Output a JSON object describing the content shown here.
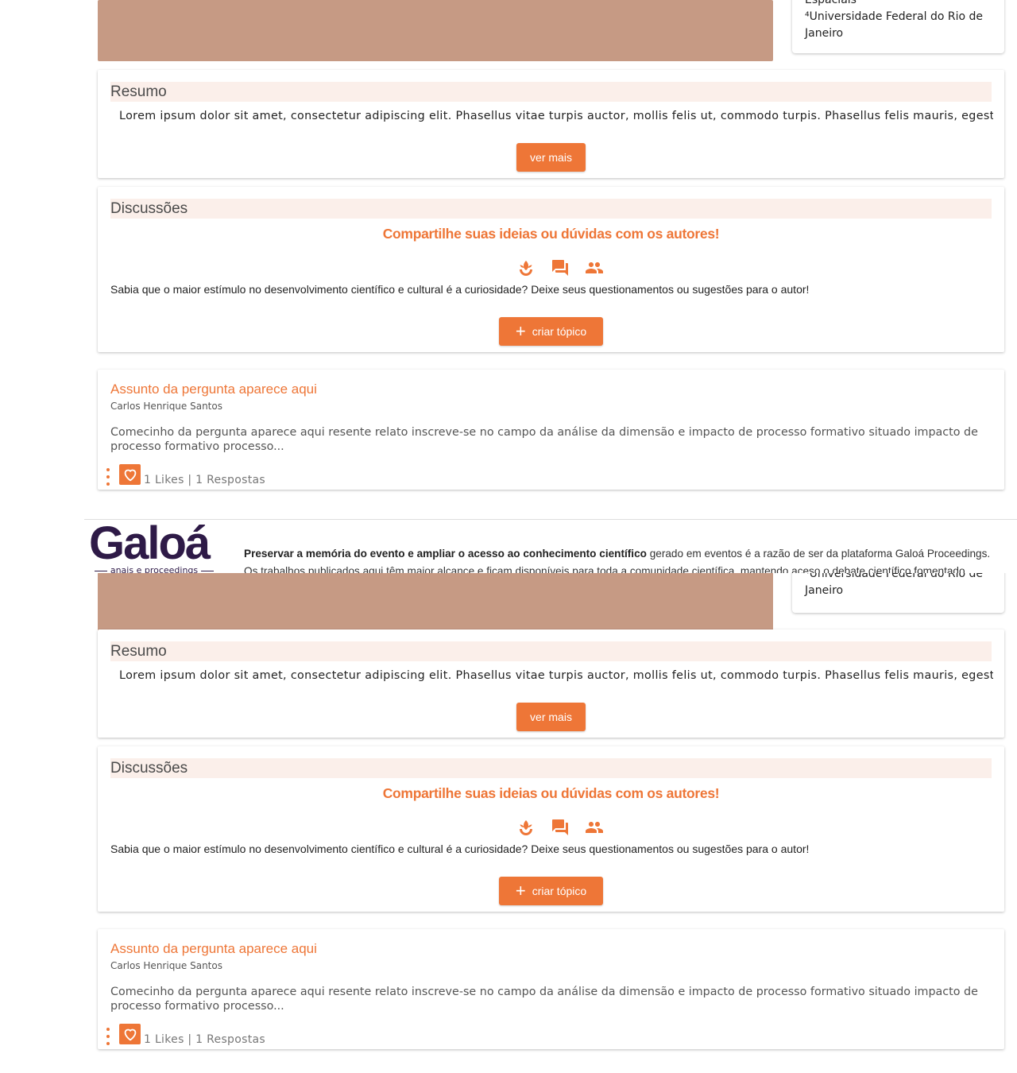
{
  "affiliations": {
    "top_partial": "Espaciais",
    "line1": "⁴Universidade Federal do Rio de",
    "line2": "Janeiro"
  },
  "resumo": {
    "title": "Resumo",
    "text": "Lorem ipsum dolor sit amet, consectetur adipiscing elit. Phasellus vitae turpis auctor, mollis felis ut, commodo turpis. Phasellus felis mauris, egestas",
    "button": "ver mais"
  },
  "discussoes": {
    "title": "Discussões",
    "cta": "Compartilhe suas ideias ou dúvidas com os autores!",
    "text": "Sabia que o maior estímulo no desenvolvimento científico e cultural é a curiosidade? Deixe seus questionamentos ou sugestões para o autor!",
    "button": "criar tópico",
    "icons": [
      "sprout-icon",
      "forum-icon",
      "people-icon"
    ]
  },
  "post": {
    "title": "Assunto da pergunta aparece aqui",
    "author": "Carlos Henrique Santos",
    "excerpt": "Comecinho da pergunta aparece aqui resente relato inscreve-se no campo da análise da dimensão e impacto de processo formativo situado impacto de processo formativo processo...",
    "stats": "1 Likes | 1 Respostas"
  },
  "footer": {
    "logo_word": "Galoá",
    "logo_sub": "anais e proceedings",
    "bold_text": "Preservar a memória do evento e ampliar o acesso ao conhecimento científico",
    "text1": " gerado em eventos é a razão de ser da plataforma Galoá Proceedings.",
    "text2": "Os trabalhos publicados aqui têm maior alcance e ficam disponíveis para toda a comunidade científica, mantendo aceso o debate científico fomentado"
  },
  "colors": {
    "accent": "#ee7637",
    "thumbnail": "#c69a84",
    "section_bg": "#fbefea",
    "logo": "#2e1a47"
  }
}
